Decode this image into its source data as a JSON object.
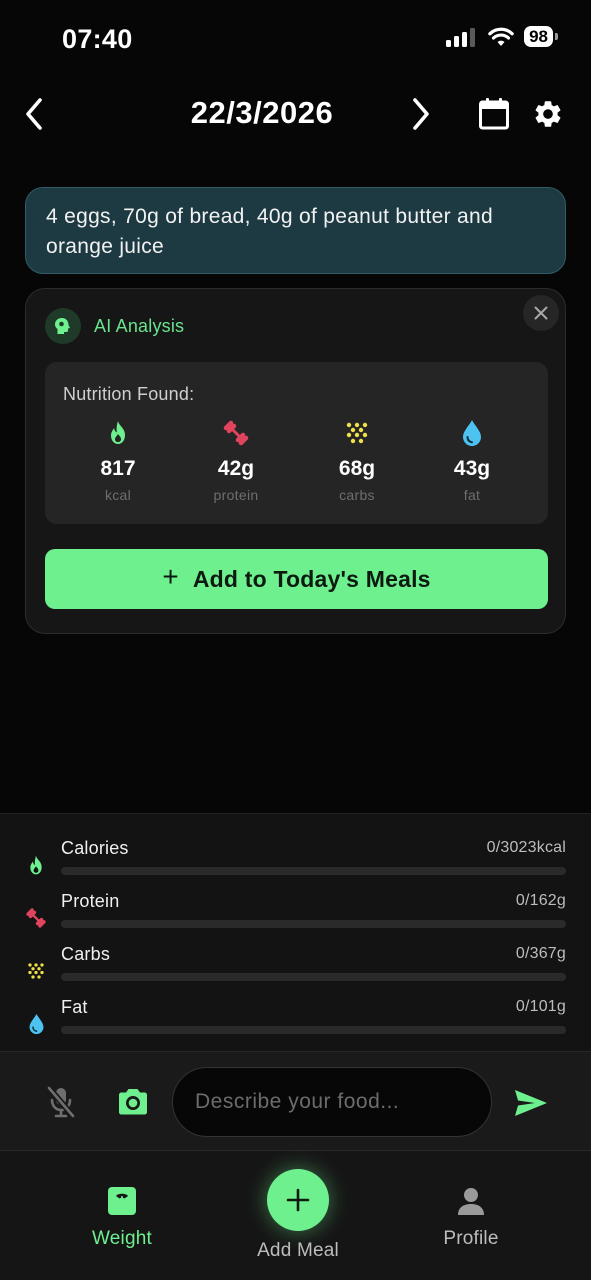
{
  "status_bar": {
    "time": "07:40",
    "battery": "98"
  },
  "header": {
    "date": "22/3/2026"
  },
  "user_message": {
    "text": "4 eggs, 70g of bread, 40g of peanut butter and orange juice"
  },
  "analysis": {
    "title": "AI Analysis",
    "nutrition_label": "Nutrition Found:",
    "items": [
      {
        "value": "817",
        "unit": "kcal",
        "icon": "flame-icon",
        "color": "#6ef08f"
      },
      {
        "value": "42g",
        "unit": "protein",
        "icon": "dumbbell-icon",
        "color": "#e0445e"
      },
      {
        "value": "68g",
        "unit": "carbs",
        "icon": "grain-icon",
        "color": "#f0e04a"
      },
      {
        "value": "43g",
        "unit": "fat",
        "icon": "drop-icon",
        "color": "#4cc3f0"
      }
    ],
    "add_button": "Add to Today's Meals"
  },
  "progress": [
    {
      "name": "Calories",
      "value_text": "0/3023kcal",
      "progress": 0,
      "color": "#6ef08f",
      "icon": "flame-icon"
    },
    {
      "name": "Protein",
      "value_text": "0/162g",
      "progress": 0,
      "color": "#e0445e",
      "icon": "dumbbell-icon"
    },
    {
      "name": "Carbs",
      "value_text": "0/367g",
      "progress": 0,
      "color": "#f0e04a",
      "icon": "grain-icon"
    },
    {
      "name": "Fat",
      "value_text": "0/101g",
      "progress": 0,
      "color": "#4cc3f0",
      "icon": "drop-icon"
    }
  ],
  "input": {
    "placeholder": "Describe your food..."
  },
  "nav": {
    "weight": "Weight",
    "add_meal": "Add Meal",
    "profile": "Profile"
  },
  "colors": {
    "accent": "#6ef08f",
    "background": "#060606"
  }
}
